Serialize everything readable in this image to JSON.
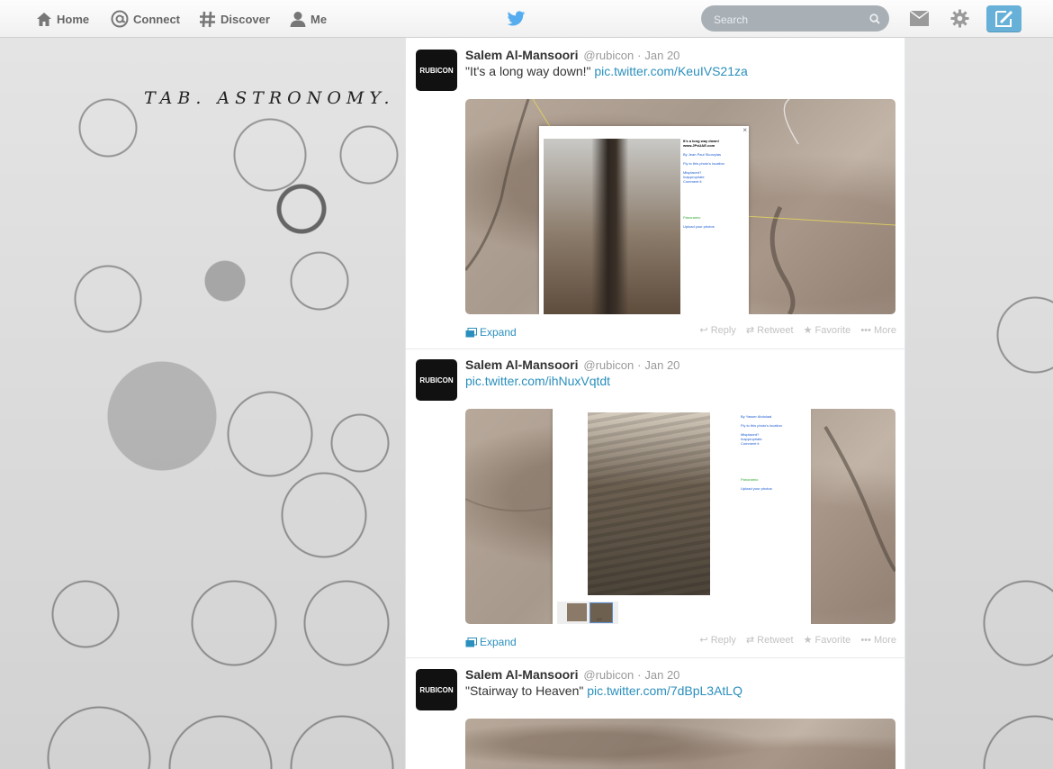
{
  "nav": {
    "home": "Home",
    "connect": "Connect",
    "discover": "Discover",
    "me": "Me"
  },
  "search": {
    "placeholder": "Search"
  },
  "background": {
    "title": "TAB. ASTRONOMY."
  },
  "tweets": [
    {
      "avatar_text": "RUBICON",
      "fullname": "Salem Al-Mansoori",
      "username": "@rubicon",
      "separator": "·",
      "date": "Jan 20",
      "text": "\"It's a long way down!\"",
      "link": "pic.twitter.com/KeuIVS21za",
      "popup": {
        "title": "It's a long way down!",
        "site": "www.JPsUAE.com",
        "author": "By Jean Paul Skorzylas",
        "fly": "Fly to this photo's location",
        "misplaced": "Misplaced?",
        "inappropriate": "Inappropriate",
        "comment": "Comment it",
        "panoramio": "Panoramio",
        "upload": "Upload your photos"
      },
      "expand": "Expand",
      "actions": {
        "reply": "Reply",
        "retweet": "Retweet",
        "favorite": "Favorite",
        "more": "More"
      }
    },
    {
      "avatar_text": "RUBICON",
      "fullname": "Salem Al-Mansoori",
      "username": "@rubicon",
      "separator": "·",
      "date": "Jan 20",
      "text": "",
      "link": "pic.twitter.com/ihNuxVqtdt",
      "popup": {
        "author": "By Yasser Abdulaal",
        "fly": "Fly to this photo's location",
        "misplaced": "Misplaced?",
        "inappropriate": "Inappropriate",
        "comment": "Comment it",
        "panoramio": "Panoramio",
        "upload": "Upload your photos",
        "counter": "2/2"
      },
      "expand": "Expand",
      "actions": {
        "reply": "Reply",
        "retweet": "Retweet",
        "favorite": "Favorite",
        "more": "More"
      }
    },
    {
      "avatar_text": "RUBICON",
      "fullname": "Salem Al-Mansoori",
      "username": "@rubicon",
      "separator": "·",
      "date": "Jan 20",
      "text": "\"Stairway to Heaven\"",
      "link": "pic.twitter.com/7dBpL3AtLQ"
    }
  ]
}
